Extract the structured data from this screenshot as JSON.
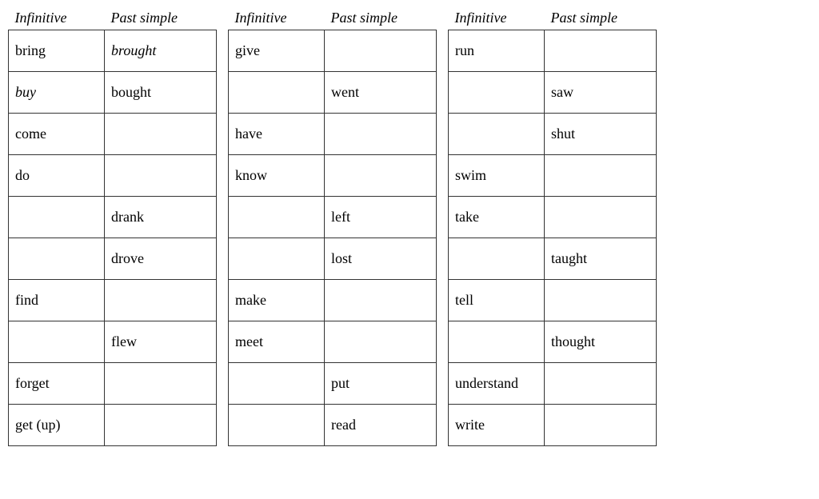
{
  "tables": [
    {
      "id": "table1",
      "headers": [
        "Infinitive",
        "Past simple"
      ],
      "rows": [
        {
          "infinitive": "bring",
          "past": "brought",
          "past_italic": true
        },
        {
          "infinitive": "buy",
          "past": "bought",
          "infinitive_italic": true
        },
        {
          "infinitive": "come",
          "past": ""
        },
        {
          "infinitive": "do",
          "past": ""
        },
        {
          "infinitive": "",
          "past": "drank"
        },
        {
          "infinitive": "",
          "past": "drove"
        },
        {
          "infinitive": "find",
          "past": ""
        },
        {
          "infinitive": "",
          "past": "flew"
        },
        {
          "infinitive": "forget",
          "past": ""
        },
        {
          "infinitive": "get (up)",
          "past": ""
        }
      ]
    },
    {
      "id": "table2",
      "headers": [
        "Infinitive",
        "Past simple"
      ],
      "rows": [
        {
          "infinitive": "give",
          "past": ""
        },
        {
          "infinitive": "",
          "past": "went"
        },
        {
          "infinitive": "have",
          "past": ""
        },
        {
          "infinitive": "know",
          "past": ""
        },
        {
          "infinitive": "",
          "past": "left"
        },
        {
          "infinitive": "",
          "past": "lost"
        },
        {
          "infinitive": "make",
          "past": ""
        },
        {
          "infinitive": "meet",
          "past": ""
        },
        {
          "infinitive": "",
          "past": "put"
        },
        {
          "infinitive": "",
          "past": "read"
        }
      ]
    },
    {
      "id": "table3",
      "headers": [
        "Infinitive",
        "Past simple"
      ],
      "rows": [
        {
          "infinitive": "run",
          "past": ""
        },
        {
          "infinitive": "",
          "past": "saw"
        },
        {
          "infinitive": "",
          "past": "shut"
        },
        {
          "infinitive": "swim",
          "past": ""
        },
        {
          "infinitive": "take",
          "past": ""
        },
        {
          "infinitive": "",
          "past": "taught"
        },
        {
          "infinitive": "tell",
          "past": ""
        },
        {
          "infinitive": "",
          "past": "thought"
        },
        {
          "infinitive": "understand",
          "past": ""
        },
        {
          "infinitive": "write",
          "past": ""
        }
      ]
    }
  ]
}
